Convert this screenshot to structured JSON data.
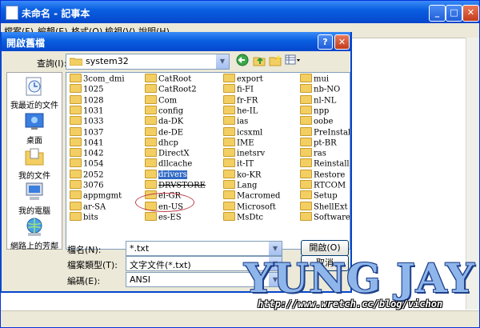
{
  "notepad": {
    "title": "未命名 - 記事本",
    "caption": {
      "minimize": "_",
      "maximize": "□",
      "close": "✕"
    },
    "menu": [
      "檔案(F)",
      "編輯(E)",
      "格式(O)",
      "檢視(V)",
      "說明(H)"
    ]
  },
  "dialog": {
    "title": "開啟舊檔",
    "help": "?",
    "close": "✕",
    "look_in_label": "查詢(I):",
    "look_in_value": "system32",
    "toolbar_icons": [
      "back-icon",
      "up-folder-icon",
      "new-folder-icon",
      "view-menu-icon"
    ],
    "places": [
      {
        "label": "我最近的文件",
        "icon": "recent-documents-icon"
      },
      {
        "label": "桌面",
        "icon": "desktop-icon"
      },
      {
        "label": "我的文件",
        "icon": "my-documents-icon"
      },
      {
        "label": "我的電腦",
        "icon": "my-computer-icon"
      },
      {
        "label": "網路上的芳鄰",
        "icon": "network-places-icon"
      }
    ],
    "columns": [
      [
        "3com_dmi",
        "1025",
        "1028",
        "1031",
        "1033",
        "1037",
        "1041",
        "1042",
        "1054",
        "2052",
        "3076",
        "appmgmt",
        "ar-SA",
        "bits"
      ],
      [
        "CatRoot",
        "CatRoot2",
        "Com",
        "config",
        "da-DK",
        "de-DE",
        "dhcp",
        "DirectX",
        "dllcache",
        "drivers",
        "DRVSTORE",
        "el-GR",
        "en-US",
        "es-ES"
      ],
      [
        "export",
        "fi-FI",
        "fr-FR",
        "he-IL",
        "ias",
        "icsxml",
        "IME",
        "inetsrv",
        "it-IT",
        "ko-KR",
        "Lang",
        "Macromed",
        "Microsoft",
        "MsDtc"
      ],
      [
        "mui",
        "nb-NO",
        "nl-NL",
        "npp",
        "oobe",
        "PreInstall",
        "pt-BR",
        "ras",
        "ReinstallBac",
        "Restore",
        "RTCOM",
        "Setup",
        "ShellExt",
        "SoftwareDis"
      ]
    ],
    "selected_item": "drivers",
    "file_name_label": "檔名(N):",
    "file_name_value": "*.txt",
    "file_type_label": "檔案類型(T):",
    "file_type_value": "文字文件(*.txt)",
    "encoding_label": "編碼(E):",
    "encoding_value": "ANSI",
    "open_button": "開啟(O)",
    "cancel_button": "取消"
  },
  "watermark": {
    "name": "YUNG JAY",
    "url": "http://www.wretch.cc/blog/vichon"
  }
}
